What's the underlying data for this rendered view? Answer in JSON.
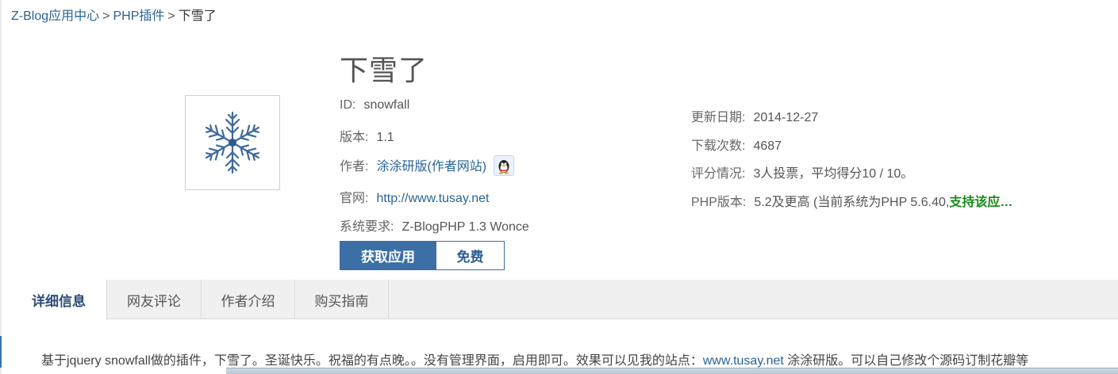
{
  "breadcrumb": {
    "root": "Z-Blog应用中心",
    "category": "PHP插件",
    "current": "下雪了",
    "separator": ">"
  },
  "app": {
    "title": "下雪了",
    "thumbnail_icon": "snowflake-icon",
    "id_label": "ID:",
    "id_value": "snowfall",
    "version_label": "版本:",
    "version_value": "1.1",
    "author_label": "作者:",
    "author_name": "涂涂研版",
    "author_site_link": "(作者网站)",
    "author_qq_icon": "qq-penguin-icon",
    "website_label": "官网:",
    "website_url": "http://www.tusay.net",
    "requirement_label": "系统要求:",
    "requirement_value": "Z-BlogPHP 1.3 Wonce",
    "updated_label": "更新日期:",
    "updated_value": "2014-12-27",
    "downloads_label": "下载次数:",
    "downloads_value": "4687",
    "rating_label": "评分情况:",
    "rating_value": "3人投票，平均得分10 / 10。",
    "php_label": "PHP版本:",
    "php_value": "5.2及更高 (当前系统为PHP 5.6.40,",
    "php_support": "支持该应…"
  },
  "actions": {
    "get_label": "获取应用",
    "price_label": "免费"
  },
  "tabs": [
    {
      "label": "详细信息",
      "active": true
    },
    {
      "label": "网友评论",
      "active": false
    },
    {
      "label": "作者介绍",
      "active": false
    },
    {
      "label": "购买指南",
      "active": false
    }
  ],
  "description": {
    "before": "基于jquery snowfall做的插件，下雪了。圣诞快乐。祝福的有点晚。。没有管理界面，启用即可。效果可以见我的站点：",
    "link": "www.tusay.net",
    "after": " 涂涂研版。可以自己修改个源码订制花瓣等"
  },
  "colors": {
    "link": "#2a6496",
    "button_primary": "#3b6fa6",
    "support_ok": "#1a8a1a",
    "tab_bar": "#f0f0f0"
  }
}
